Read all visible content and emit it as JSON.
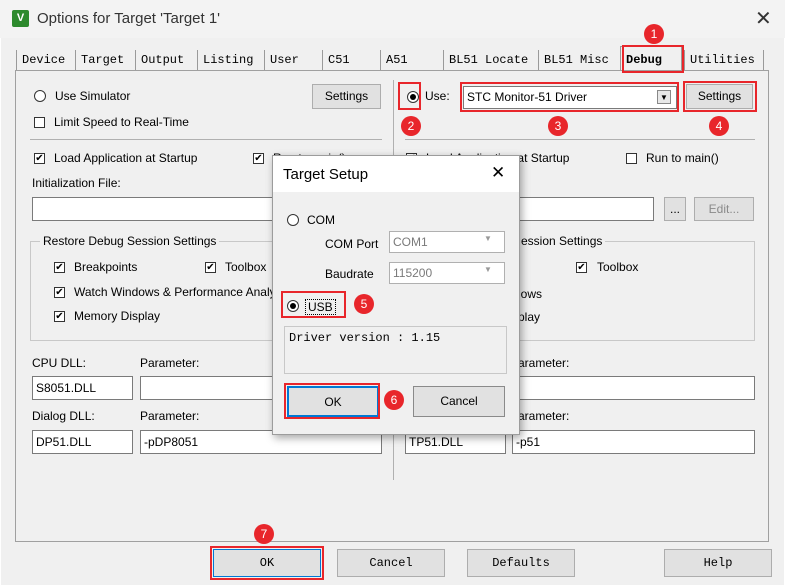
{
  "window": {
    "title": "Options for Target 'Target 1'",
    "close_glyph": "✕",
    "app_icon_glyph": "V"
  },
  "tabs": [
    "Device",
    "Target",
    "Output",
    "Listing",
    "User",
    "C51",
    "A51",
    "BL51 Locate",
    "BL51 Misc",
    "Debug",
    "Utilities"
  ],
  "left": {
    "use_simulator": "Use Simulator",
    "settings_button": "Settings",
    "limit_speed": "Limit Speed to Real-Time",
    "load_app": "Load Application at Startup",
    "run_to_main_partial": "Run to main()",
    "init_file_label": "Initialization File:",
    "restore_group": "Restore Debug Session Settings",
    "breakpoints": "Breakpoints",
    "toolbox": "Toolbox",
    "watch_windows": "Watch Windows & Performance Analyzer",
    "memory_display": "Memory Display",
    "cpu_dll_label": "CPU DLL:",
    "parameter_label": "Parameter:",
    "cpu_dll_value": "S8051.DLL",
    "dialog_dll_label": "Dialog DLL:",
    "dialog_dll_value": "DP51.DLL",
    "dialog_param_value": "-pDP8051"
  },
  "right": {
    "use_label": "Use:",
    "driver_value": "STC Monitor-51 Driver",
    "settings_button": "Settings",
    "load_app": "Load Application at Startup",
    "run_to_main": "Run to main()",
    "browse_button": "...",
    "edit_button": "Edit...",
    "restore_group_partial": "ession Settings",
    "toolbox": "Toolbox",
    "watch_partial": "lows",
    "memory_partial": "play",
    "parameter_partial": "arameter:",
    "dialog_dll_value": "TP51.DLL",
    "dialog_param_value": "-p51"
  },
  "dialog": {
    "title": "Target Setup",
    "close_glyph": "✕",
    "com_label": "COM",
    "com_port_label": "COM Port",
    "com_port_value": "COM1",
    "baudrate_label": "Baudrate",
    "baudrate_value": "115200",
    "usb_label": "USB",
    "driver_version": "Driver version : 1.15",
    "ok_button": "OK",
    "cancel_button": "Cancel"
  },
  "bottom_buttons": {
    "ok": "OK",
    "cancel": "Cancel",
    "defaults": "Defaults",
    "help": "Help"
  },
  "annotations": [
    "1",
    "2",
    "3",
    "4",
    "5",
    "6",
    "7"
  ],
  "colors": {
    "annotation_red": "#e8262b",
    "panel_bg": "#f0f0f0"
  }
}
